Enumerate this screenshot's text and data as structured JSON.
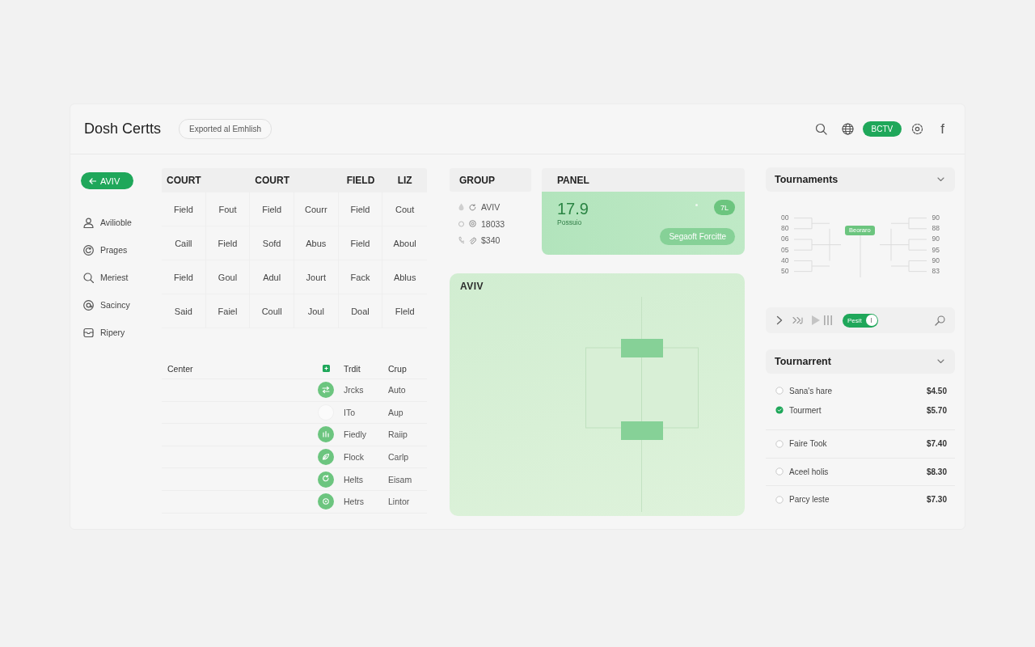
{
  "header": {
    "title": "Dosh Certts",
    "badge": "Exported al Emhlish",
    "account_button": "BCTV",
    "social_link": "f"
  },
  "sidebar": {
    "back_button": "AVIV",
    "items": [
      "Avilioble",
      "Prages",
      "Meriest",
      "Sacincy",
      "Ripery"
    ]
  },
  "court_grid": {
    "columns": [
      "COURT",
      "",
      "COURT",
      "",
      "FIELD",
      "LIZ"
    ],
    "rows": [
      [
        "Field",
        "Fout",
        "Field",
        "Courr",
        "Field",
        "Cout"
      ],
      [
        "Caill",
        "Field",
        "Sofd",
        "Abus",
        "Field",
        "Aboul"
      ],
      [
        "Field",
        "Goul",
        "Adul",
        "Jourt",
        "Fack",
        "Ablus"
      ],
      [
        "Said",
        "Faiel",
        "Coull",
        "Joul",
        "Doal",
        "Fleld"
      ]
    ]
  },
  "roster": {
    "columns": [
      "Center",
      "Trdit",
      "Crup"
    ],
    "rows": [
      {
        "name": "Jrcks",
        "group": "Auto",
        "active": true
      },
      {
        "name": "ITo",
        "group": "Aup",
        "active": false
      },
      {
        "name": "Fiedly",
        "group": "Raiip",
        "active": true
      },
      {
        "name": "Flock",
        "group": "Carlp",
        "active": true
      },
      {
        "name": "Helts",
        "group": "Eisam",
        "active": true
      },
      {
        "name": "Hetrs",
        "group": "Lintor",
        "active": true
      }
    ]
  },
  "group": {
    "title": "GROUP",
    "items": [
      "AVIV",
      "18033",
      "$340"
    ]
  },
  "panel": {
    "title": "PANEL",
    "value": "17.9",
    "caption": "Possuio",
    "badge": "7L",
    "button": "Segaoft Forcitte"
  },
  "field": {
    "title": "AVIV"
  },
  "tournaments": {
    "title": "Tournaments",
    "left_scores": [
      "00",
      "80",
      "06",
      "05",
      "40",
      "50"
    ],
    "right_scores": [
      "90",
      "88",
      "90",
      "95",
      "90",
      "83"
    ],
    "tag": "Beoraro"
  },
  "player": {
    "toggle_label": "Pesit",
    "on": true
  },
  "tournament_list": {
    "title": "Tournarrent",
    "items": [
      {
        "name": "Sana's hare",
        "price": "$4.50",
        "selected": false
      },
      {
        "name": "Tourmert",
        "price": "$5.70",
        "selected": true
      },
      {
        "name": "Faire Took",
        "price": "$7.40",
        "selected": false
      },
      {
        "name": "Aceel holis",
        "price": "$8.30",
        "selected": false
      },
      {
        "name": "Parcy leste",
        "price": "$7.30",
        "selected": false
      }
    ]
  }
}
